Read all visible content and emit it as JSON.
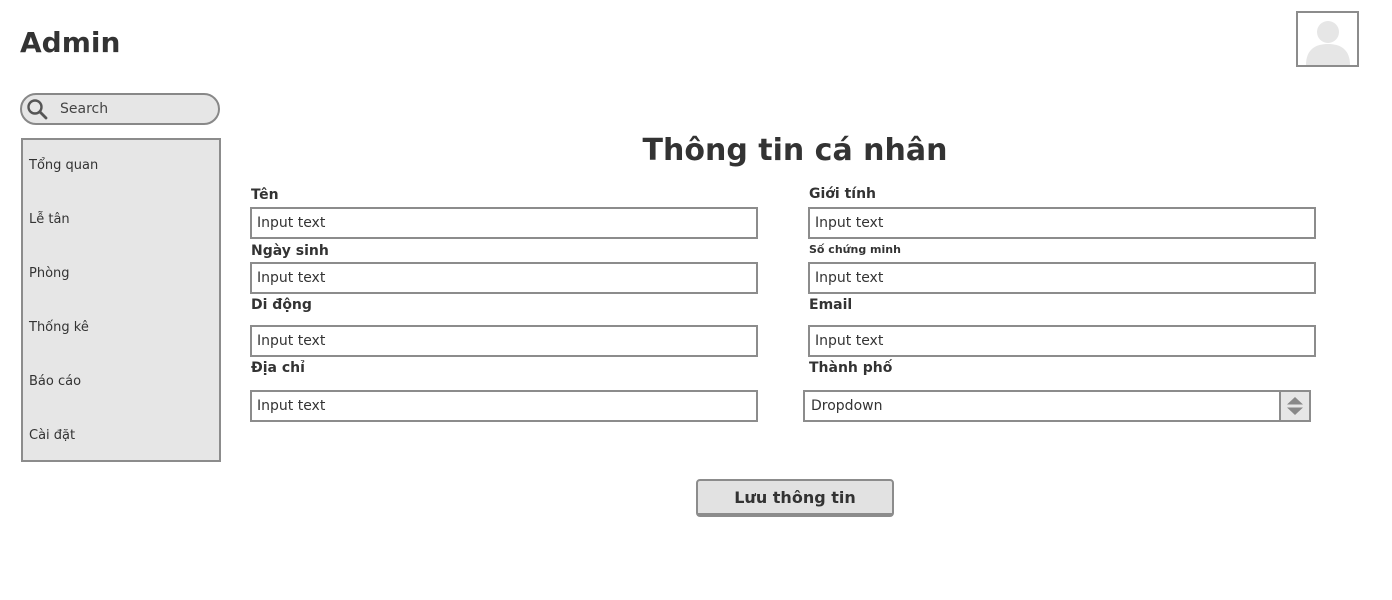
{
  "app": {
    "title": "Admin"
  },
  "search": {
    "placeholder": "Search"
  },
  "sidebar": {
    "items": [
      {
        "label": "Tổng quan"
      },
      {
        "label": "Lễ tân"
      },
      {
        "label": "Phòng"
      },
      {
        "label": "Thống kê"
      },
      {
        "label": "Báo cáo"
      },
      {
        "label": "Cài đặt"
      }
    ]
  },
  "form": {
    "title": "Thông tin cá nhân",
    "fields": {
      "name": {
        "label": "Tên",
        "value": "Input text"
      },
      "gender": {
        "label": "Giới tính",
        "value": "Input text"
      },
      "birthday": {
        "label": "Ngày sinh",
        "value": "Input text"
      },
      "id_number": {
        "label": "Số chứng minh",
        "value": "Input text"
      },
      "mobile": {
        "label": "Di động",
        "value": "Input text"
      },
      "email": {
        "label": "Email",
        "value": "Input text"
      },
      "address": {
        "label": "Địa chỉ",
        "value": "Input text"
      },
      "city": {
        "label": "Thành phố",
        "value": "Dropdown"
      }
    },
    "save_label": "Lưu thông tin"
  },
  "icons": {
    "avatar": "user-avatar-icon",
    "search": "search-icon",
    "dropdown": "up-down-stepper-icon"
  },
  "colors": {
    "border": "#8c8c8c",
    "panel": "#e6e6e6",
    "text": "#333333"
  }
}
